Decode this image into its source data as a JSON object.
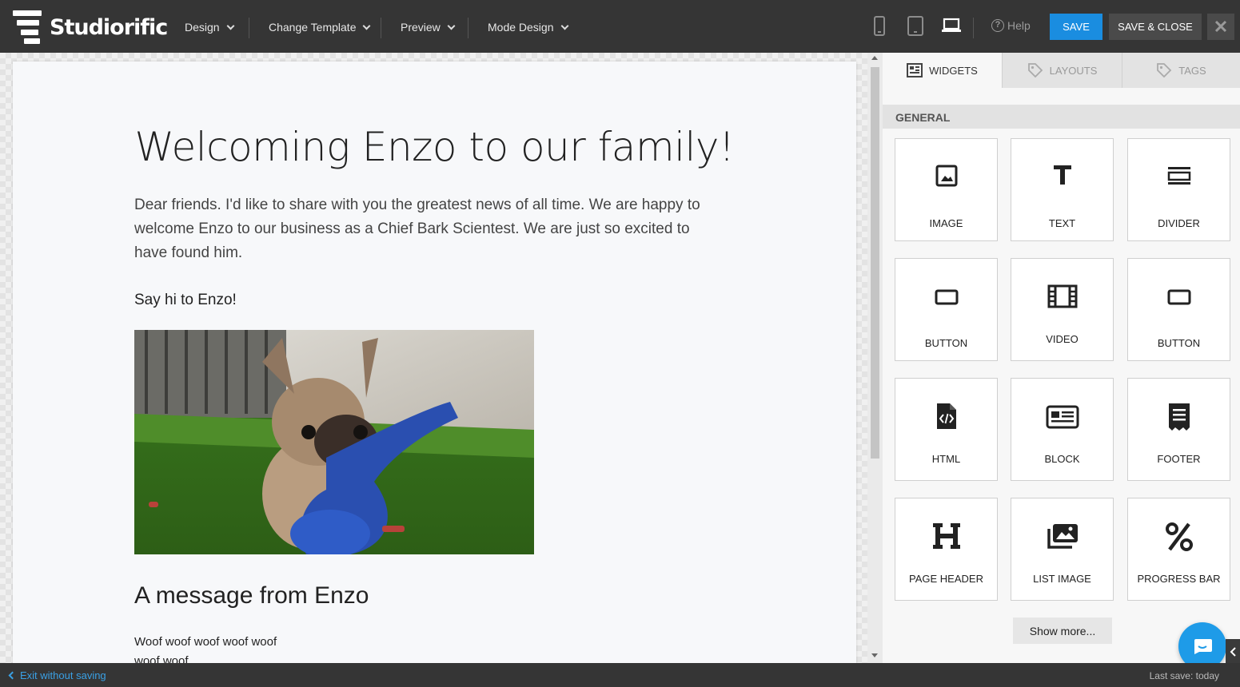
{
  "app": {
    "brand": "Studiorific"
  },
  "menu": {
    "design": "Design",
    "change_template": "Change Template",
    "preview": "Preview",
    "mode_design": "Mode Design"
  },
  "toolbar": {
    "help": "Help",
    "save": "SAVE",
    "save_close": "SAVE & CLOSE",
    "devices": [
      "mobile-icon",
      "tablet-icon",
      "laptop-icon"
    ],
    "accent_color": "#1a8de0"
  },
  "email": {
    "title": "Welcoming Enzo to our family!",
    "intro": "Dear friends. I'd like to share with you the greatest news of all time. We are happy to welcome Enzo to our business as a Chief Bark Scientest. We are just so excited to have found him.",
    "say_hi": "Say hi to Enzo!",
    "message_heading": "A message from Enzo",
    "woof_line1": "Woof woof woof woof woof",
    "woof_line2": "woof woof"
  },
  "panel": {
    "tabs": [
      "WIDGETS",
      "LAYOUTS",
      "TAGS"
    ],
    "section": "GENERAL",
    "widgets": [
      "IMAGE",
      "TEXT",
      "DIVIDER",
      "BUTTON",
      "VIDEO",
      "BUTTON",
      "HTML",
      "BLOCK",
      "FOOTER",
      "PAGE HEADER",
      "LIST IMAGE",
      "PROGRESS BAR"
    ],
    "show_more": "Show more..."
  },
  "footer": {
    "exit": "Exit without saving",
    "last_save": "Last save: today"
  }
}
